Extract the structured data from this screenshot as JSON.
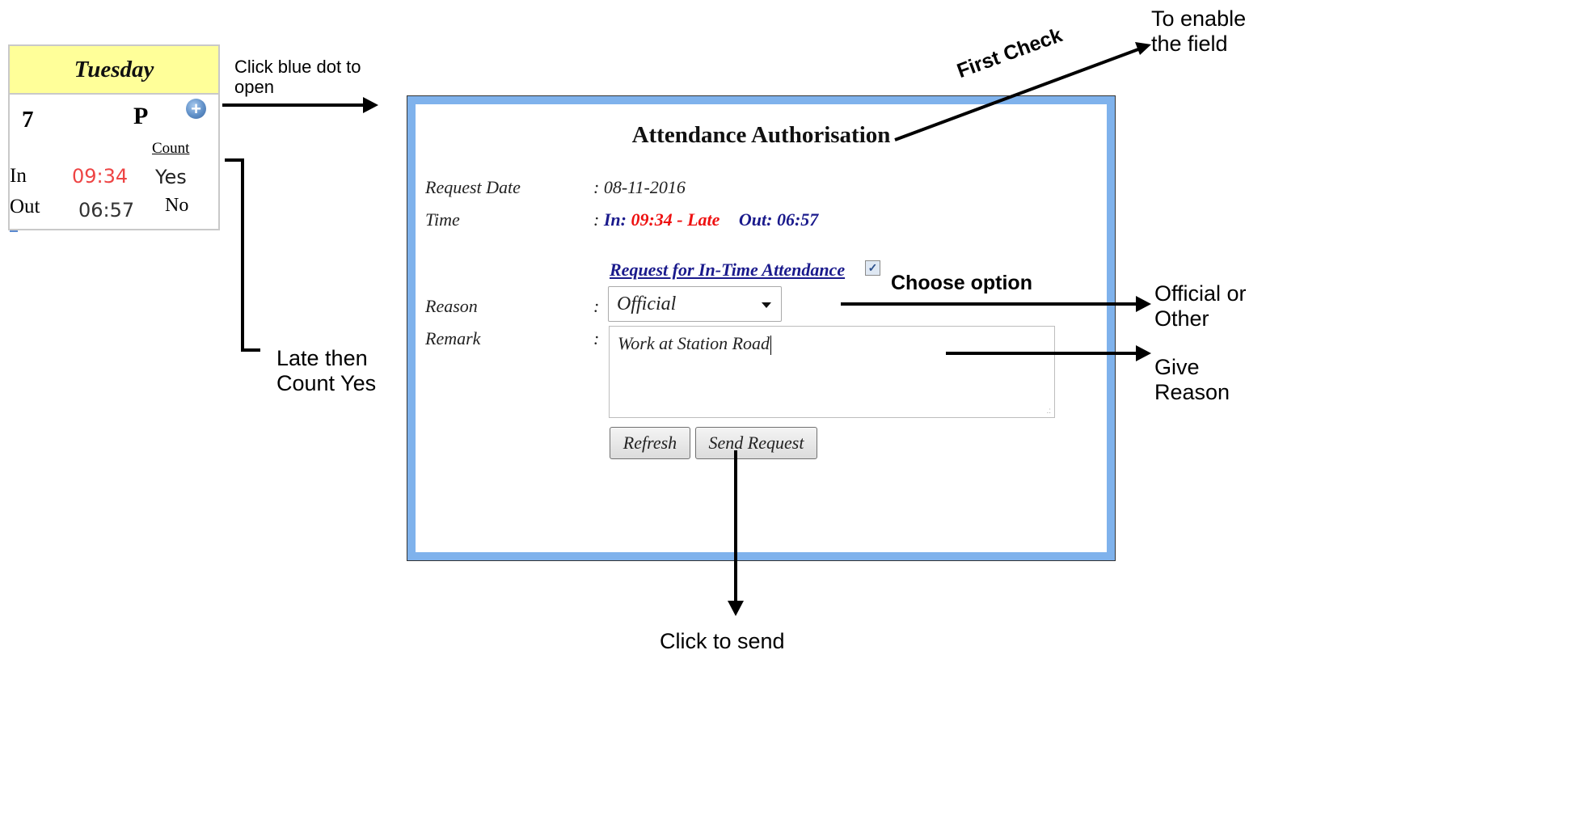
{
  "day_card": {
    "day_name": "Tuesday",
    "date_number": "7",
    "status": "P",
    "open_icon": "plus-circle-icon",
    "count_header": "Count",
    "in_label": "In",
    "in_time": "09:34",
    "in_count": "Yes",
    "out_label": "Out",
    "out_time": "06:57",
    "out_count": "No"
  },
  "dialog": {
    "title": "Attendance Authorisation",
    "request_date_label": "Request Date",
    "separator": ":",
    "request_date_value": "08-11-2016",
    "time_label": "Time",
    "in_prefix": "In:",
    "in_value": "09:34 - Late",
    "out_prefix": "Out:",
    "out_value": "06:57",
    "request_link": "Request for In-Time Attendance",
    "checkbox_checked": true,
    "reason_label": "Reason",
    "reason_selected": "Official",
    "remark_label": "Remark",
    "remark_value": "Work at Station Road",
    "refresh_button": "Refresh",
    "send_button": "Send Request"
  },
  "annotations": {
    "click_blue_dot": "Click blue dot to open",
    "late_then_count": "Late then Count Yes",
    "first_check": "First Check",
    "to_enable": "To enable the field",
    "choose_option": "Choose option",
    "official_or_other": "Official or Other",
    "give_reason": "Give Reason",
    "click_to_send": "Click to send"
  },
  "colors": {
    "card_header_bg": "#ffff99",
    "dialog_frame": "#7fb2ec",
    "late_red": "#ee1111",
    "label_blue": "#1a1a8c"
  }
}
